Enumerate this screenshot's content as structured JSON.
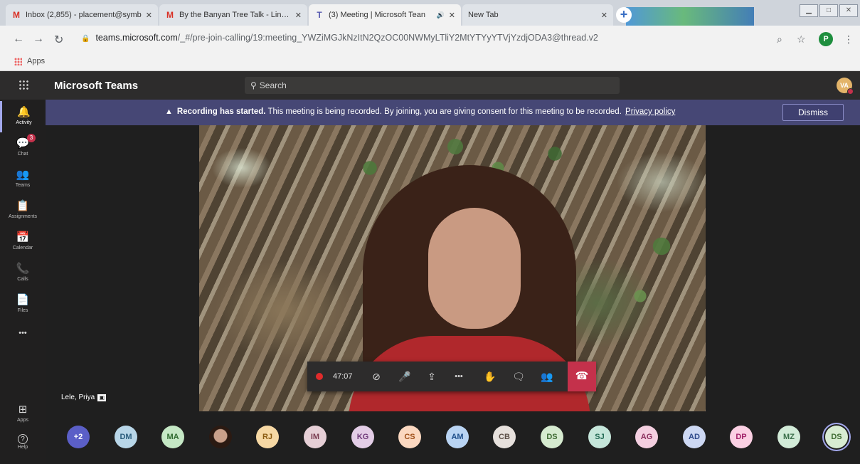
{
  "browser": {
    "tabs": [
      {
        "title": "Inbox (2,855) - placement@symb",
        "icon": "gmail-icon",
        "active": false
      },
      {
        "title": "By the Banyan Tree Talk - Link- (",
        "icon": "gmail-icon",
        "active": false
      },
      {
        "title": "(3) Meeting | Microsoft Tean",
        "icon": "teams-icon",
        "active": true,
        "audio": "🔊"
      },
      {
        "title": "New Tab",
        "icon": "",
        "active": false
      }
    ],
    "close_glyph": "✕",
    "new_tab_glyph": "+",
    "url_host": "teams.microsoft.com",
    "url_path": "/_#/pre-join-calling/19:meeting_YWZiMGJkNzItN2QzOC00NWMyLTliY2MtYTYyYTVjYzdjODA3@thread.v2",
    "profile_initial": "P",
    "bookmarks_label": "Apps"
  },
  "teams": {
    "app_name": "Microsoft Teams",
    "search_placeholder": "Search",
    "me_initials": "VA",
    "rail": [
      {
        "label": "Activity",
        "icon": "bell-icon",
        "glyph": "🔔"
      },
      {
        "label": "Chat",
        "icon": "chat-icon",
        "glyph": "💬",
        "badge": "3"
      },
      {
        "label": "Teams",
        "icon": "teams-icon",
        "glyph": "👥"
      },
      {
        "label": "Assignments",
        "icon": "assignments-icon",
        "glyph": "📋"
      },
      {
        "label": "Calendar",
        "icon": "calendar-icon",
        "glyph": "📅"
      },
      {
        "label": "Calls",
        "icon": "phone-icon",
        "glyph": "📞"
      },
      {
        "label": "Files",
        "icon": "file-icon",
        "glyph": "📄"
      },
      {
        "label": "",
        "icon": "more-icon",
        "glyph": "•••"
      }
    ],
    "rail_bottom": [
      {
        "label": "Apps",
        "icon": "apps-icon",
        "glyph": "⊞"
      },
      {
        "label": "Help",
        "icon": "help-icon",
        "glyph": "?"
      }
    ]
  },
  "meeting": {
    "banner_bold": "Recording has started.",
    "banner_text": " This meeting is being recorded. By joining, you are giving consent for this meeting to be recorded.",
    "banner_link": "Privacy policy",
    "dismiss_label": "Dismiss",
    "speaker_name": "Lele, Priya",
    "timer": "47:07",
    "controls": [
      {
        "name": "camera-off-icon",
        "glyph": "⊘"
      },
      {
        "name": "mic-off-icon",
        "glyph": "🎤"
      },
      {
        "name": "share-screen-icon",
        "glyph": "⇪"
      },
      {
        "name": "more-actions-icon",
        "glyph": "•••"
      },
      {
        "name": "raise-hand-icon",
        "glyph": "✋"
      },
      {
        "name": "chat-panel-icon",
        "glyph": "🗨"
      },
      {
        "name": "participants-icon",
        "glyph": "👥"
      }
    ],
    "hangup_glyph": "☎"
  },
  "participants": [
    {
      "initials": "+2",
      "bg": "#5b5fc7",
      "fg": "#ffffff"
    },
    {
      "initials": "DM",
      "bg": "#b8d6e8",
      "fg": "#2b5e7e"
    },
    {
      "initials": "MA",
      "bg": "#c5e8c5",
      "fg": "#2f6b2f"
    },
    {
      "initials": "",
      "bg": "photo",
      "fg": ""
    },
    {
      "initials": "RJ",
      "bg": "#f6d8a4",
      "fg": "#8a5a10"
    },
    {
      "initials": "IM",
      "bg": "#e6cfd6",
      "fg": "#7a3e52"
    },
    {
      "initials": "KG",
      "bg": "#e3cde6",
      "fg": "#6f3b7a"
    },
    {
      "initials": "CS",
      "bg": "#fbd8c0",
      "fg": "#a0501a"
    },
    {
      "initials": "AM",
      "bg": "#b9d4f3",
      "fg": "#1f4f8b"
    },
    {
      "initials": "CB",
      "bg": "#e6e0dc",
      "fg": "#5d5048"
    },
    {
      "initials": "DS",
      "bg": "#d6ebd0",
      "fg": "#3f6b33"
    },
    {
      "initials": "SJ",
      "bg": "#c5e6da",
      "fg": "#246b55"
    },
    {
      "initials": "AG",
      "bg": "#f4cfe0",
      "fg": "#8b2f5d"
    },
    {
      "initials": "AD",
      "bg": "#cdd8f3",
      "fg": "#2e4a8b"
    },
    {
      "initials": "DP",
      "bg": "#fbd0e3",
      "fg": "#a3236a"
    },
    {
      "initials": "MZ",
      "bg": "#d2ebd8",
      "fg": "#3b6f4a"
    },
    {
      "initials": "DS",
      "bg": "#d8ecd2",
      "fg": "#3f6b33",
      "selected": true
    }
  ]
}
